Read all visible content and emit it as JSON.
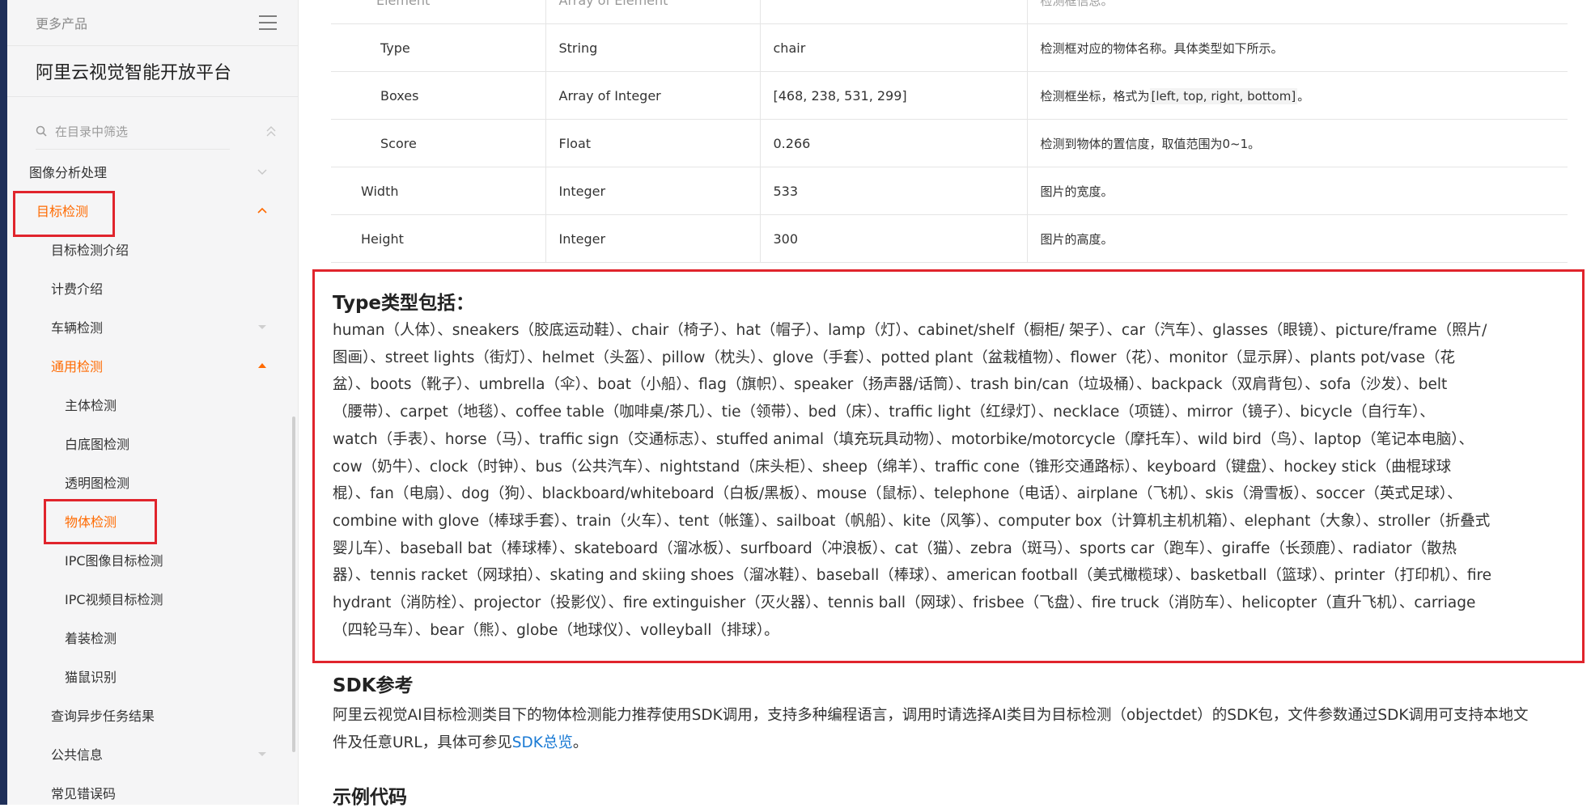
{
  "sidebar": {
    "more_products": "更多产品",
    "title": "阿里云视觉智能开放平台",
    "filter_placeholder": "在目录中筛选",
    "items": [
      {
        "label": "图像分析处理"
      },
      {
        "label": "目标检测"
      },
      {
        "label": "目标检测介绍"
      },
      {
        "label": "计费介绍"
      },
      {
        "label": "车辆检测"
      },
      {
        "label": "通用检测"
      },
      {
        "label": "主体检测"
      },
      {
        "label": "白底图检测"
      },
      {
        "label": "透明图检测"
      },
      {
        "label": "物体检测"
      },
      {
        "label": "IPC图像目标检测"
      },
      {
        "label": "IPC视频目标检测"
      },
      {
        "label": "着装检测"
      },
      {
        "label": "猫鼠识别"
      },
      {
        "label": "查询异步任务结果"
      },
      {
        "label": "公共信息"
      },
      {
        "label": "常见错误码"
      }
    ],
    "accent_color": "#ff6a00"
  },
  "params_table": {
    "partial_row": [
      "Element",
      "Array of Element",
      "",
      "检测框信息。"
    ],
    "rows": [
      {
        "name": "Type",
        "type": "String",
        "example": "chair",
        "desc": "检测框对应的物体名称。具体类型如下所示。"
      },
      {
        "name": "Boxes",
        "type": "Array of Integer",
        "example": "[468, 238, 531, 299]",
        "desc_pre": "检测框坐标，格式为",
        "desc_code": "[left, top, right, bottom]",
        "desc_post": "。"
      },
      {
        "name": "Score",
        "type": "Float",
        "example": "0.266",
        "desc": "检测到物体的置信度，取值范围为0~1。"
      },
      {
        "name": "Width",
        "type": "Integer",
        "example": "533",
        "desc": "图片的宽度。"
      },
      {
        "name": "Height",
        "type": "Integer",
        "example": "300",
        "desc": "图片的高度。"
      }
    ]
  },
  "type_section": {
    "title": "Type类型包括：",
    "lines": [
      "human（人体）、sneakers（胶底运动鞋）、chair（椅子）、hat（帽子）、lamp（灯）、cabinet/shelf（橱柜/ 架子）、car（汽车）、glasses（眼镜）、picture/frame（照片/",
      "图画）、street lights（街灯）、helmet（头盔）、pillow（枕头）、glove（手套）、potted plant（盆栽植物）、flower（花）、monitor（显示屏）、plants pot/vase（花",
      "盆）、boots（靴子）、umbrella（伞）、boat（小船）、flag（旗帜）、speaker（扬声器/话筒）、trash bin/can（垃圾桶）、backpack（双肩背包）、sofa（沙发）、belt",
      "（腰带）、carpet（地毯）、coffee table（咖啡桌/茶几）、tie（领带）、bed（床）、traffic light（红绿灯）、necklace（项链）、mirror（镜子）、bicycle（自行车）、",
      "watch（手表）、horse（马）、traffic sign（交通标志）、stuffed animal（填充玩具动物）、motorbike/motorcycle（摩托车）、wild bird（鸟）、laptop（笔记本电脑）、",
      "cow（奶牛）、clock（时钟）、bus（公共汽车）、nightstand（床头柜）、sheep（绵羊）、traffic cone（锥形交通路标）、keyboard（键盘）、hockey stick（曲棍球球",
      "棍）、fan（电扇）、dog（狗）、blackboard/whiteboard（白板/黑板）、mouse（鼠标）、telephone（电话）、airplane（飞机）、skis（滑雪板）、soccer（英式足球）、",
      "combine with glove（棒球手套）、train（火车）、tent（帐篷）、sailboat（帆船）、kite（风筝）、computer box（计算机主机机箱）、elephant（大象）、stroller（折叠式",
      "婴儿车）、baseball bat（棒球棒）、skateboard（溜冰板）、surfboard（冲浪板）、cat（猫）、zebra（斑马）、sports car（跑车）、giraffe（长颈鹿）、radiator（散热",
      "器）、tennis racket（网球拍）、skating and skiing shoes（溜冰鞋）、baseball（棒球）、american football（美式橄榄球）、basketball（篮球）、printer（打印机）、fire",
      "hydrant（消防栓）、projector（投影仪）、fire extinguisher（灭火器）、tennis ball（网球）、frisbee（飞盘）、fire truck（消防车）、helicopter（直升飞机）、carriage",
      "（四轮马车）、bear（熊）、globe（地球仪）、volleyball（排球）。"
    ]
  },
  "sdk_section": {
    "title": "SDK参考",
    "text_line1": "阿里云视觉AI目标检测类目下的物体检测能力推荐使用SDK调用，支持多种编程语言，调用时请选择AI类目为目标检测（objectdet）的SDK包，文件参数通过SDK调用可支持本地文",
    "text_line2_pre": "件及任意URL，具体可参见",
    "link": "SDK总览",
    "text_line2_post": "。"
  },
  "example_section": {
    "title": "示例代码"
  }
}
